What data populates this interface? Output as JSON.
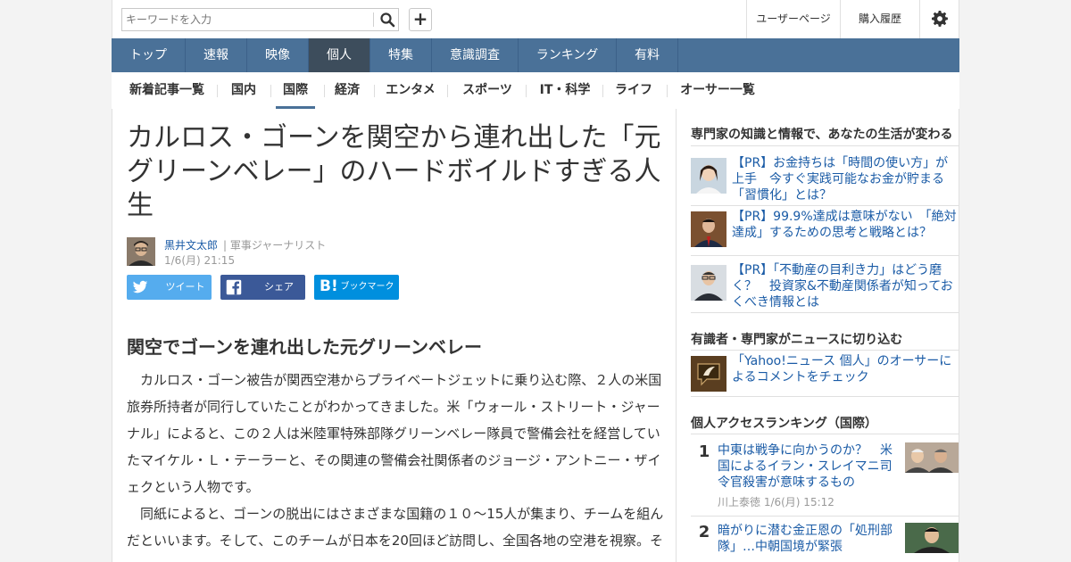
{
  "header": {
    "search_placeholder": "キーワードを入力",
    "user_page": "ユーザーページ",
    "purchase_history": "購入履歴"
  },
  "nav_main": [
    "トップ",
    "速報",
    "映像",
    "個人",
    "特集",
    "意識調査",
    "ランキング",
    "有料"
  ],
  "nav_main_active": "個人",
  "nav_sub": [
    "新着記事一覧",
    "国内",
    "国際",
    "経済",
    "エンタメ",
    "スポーツ",
    "IT・科学",
    "ライフ",
    "オーサー一覧"
  ],
  "nav_sub_active": "国際",
  "article": {
    "title": "カルロス・ゴーンを関空から連れ出した「元グリーンベレー」のハードボイルドすぎる人生",
    "author": "黒井文太郎",
    "role": "| 軍事ジャーナリスト",
    "date": "1/6(月) 21:15",
    "share": {
      "tweet": "ツイート",
      "share": "シェア",
      "bookmark": "ブックマーク"
    },
    "subhead": "関空でゴーンを連れ出した元グリーンベレー",
    "paragraphs": [
      "カルロス・ゴーン被告が関西空港からプライベートジェットに乗り込む際、２人の米国旅券所持者が同行していたことがわかってきました。米「ウォール・ストリート・ジャーナル」によると、この２人は米陸軍特殊部隊グリーンベレー隊員で警備会社を経営していたマイケル・Ｌ・テーラーと、その関連の警備会社関係者のジョージ・アントニー・ザイェクという人物です。",
      "同紙によると、ゴーンの脱出にはさまざまな国籍の１０～15人が集まり、チームを組んだといいます。そして、このチームが日本を20回ほど訪問し、全国各地の空港を視察。そ"
    ]
  },
  "sidebar": {
    "pr_title": "専門家の知識と情報で、あなたの生活が変わる",
    "pr_items": [
      "【PR】お金持ちは「時間の使い方」が上手　今すぐ実践可能なお金が貯まる「習慣化」とは？",
      "【PR】99.9%達成は意味がない　「絶対達成」するための思考と戦略とは？",
      "【PR】「不動産の目利き力」はどう磨く？　投資家&不動産関係者が知っておくべき情報とは"
    ],
    "expert_title": "有識者・専門家がニュースに切り込む",
    "expert_item": "「Yahoo!ニュース 個人」のオーサーによるコメントをチェック",
    "ranking_title": "個人アクセスランキング（国際）",
    "ranking": [
      {
        "num": "1",
        "text": "中東は戦争に向かうのか？　米国によるイラン・スレイマニ司令官殺害が意味するもの",
        "meta": "川上泰徳  1/6(月) 15:12"
      },
      {
        "num": "2",
        "text": "暗がりに潜む金正恩の「処刑部隊」…中朝国境が緊張",
        "meta": ""
      }
    ]
  },
  "colors": {
    "nav_bg": "#4a7198",
    "nav_active": "#3d4d5c",
    "link": "#1a5ba6",
    "twitter": "#55acee",
    "facebook": "#3b5998",
    "hatena": "#008fde"
  }
}
